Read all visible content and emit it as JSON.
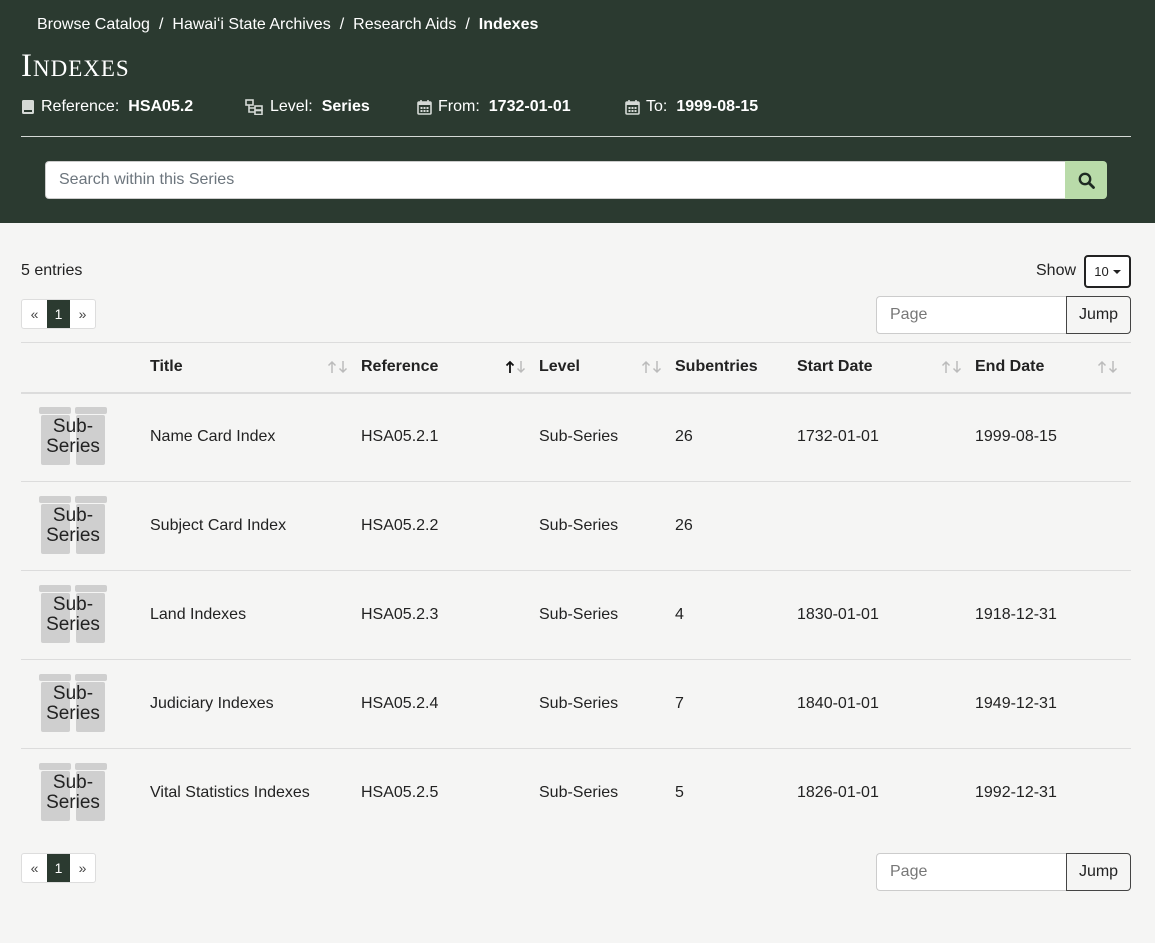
{
  "breadcrumb": [
    "Browse Catalog",
    "Hawaiʻi State Archives",
    "Research Aids",
    "Indexes"
  ],
  "page_title": "Indexes",
  "meta": {
    "reference_label": "Reference:",
    "reference_value": "HSA05.2",
    "level_label": "Level:",
    "level_value": "Series",
    "from_label": "From:",
    "from_value": "1732-01-01",
    "to_label": "To:",
    "to_value": "1999-08-15"
  },
  "search": {
    "placeholder": "Search within this Series"
  },
  "controls": {
    "entries": "5 entries",
    "show_label": "Show",
    "page_size": "10",
    "current_page": "1",
    "prev": "«",
    "next": "»",
    "page_placeholder": "Page",
    "jump_label": "Jump"
  },
  "table": {
    "headers": [
      "Title",
      "Reference",
      "Level",
      "Subentries",
      "Start Date",
      "End Date"
    ],
    "sort": {
      "column": "Reference",
      "direction": "ascending"
    },
    "icon_label": "Sub-Series",
    "rows": [
      {
        "title": "Name Card Index",
        "reference": "HSA05.2.1",
        "level": "Sub-Series",
        "subentries": "26",
        "start": "1732-01-01",
        "end": "1999-08-15"
      },
      {
        "title": "Subject Card Index",
        "reference": "HSA05.2.2",
        "level": "Sub-Series",
        "subentries": "26",
        "start": "",
        "end": ""
      },
      {
        "title": "Land Indexes",
        "reference": "HSA05.2.3",
        "level": "Sub-Series",
        "subentries": "4",
        "start": "1830-01-01",
        "end": "1918-12-31"
      },
      {
        "title": "Judiciary Indexes",
        "reference": "HSA05.2.4",
        "level": "Sub-Series",
        "subentries": "7",
        "start": "1840-01-01",
        "end": "1949-12-31"
      },
      {
        "title": "Vital Statistics Indexes",
        "reference": "HSA05.2.5",
        "level": "Sub-Series",
        "subentries": "5",
        "start": "1826-01-01",
        "end": "1992-12-31"
      }
    ]
  },
  "colors": {
    "header_bg": "#2b3a30",
    "search_button": "#b9dba9",
    "page_bg": "#f5f5f4"
  }
}
